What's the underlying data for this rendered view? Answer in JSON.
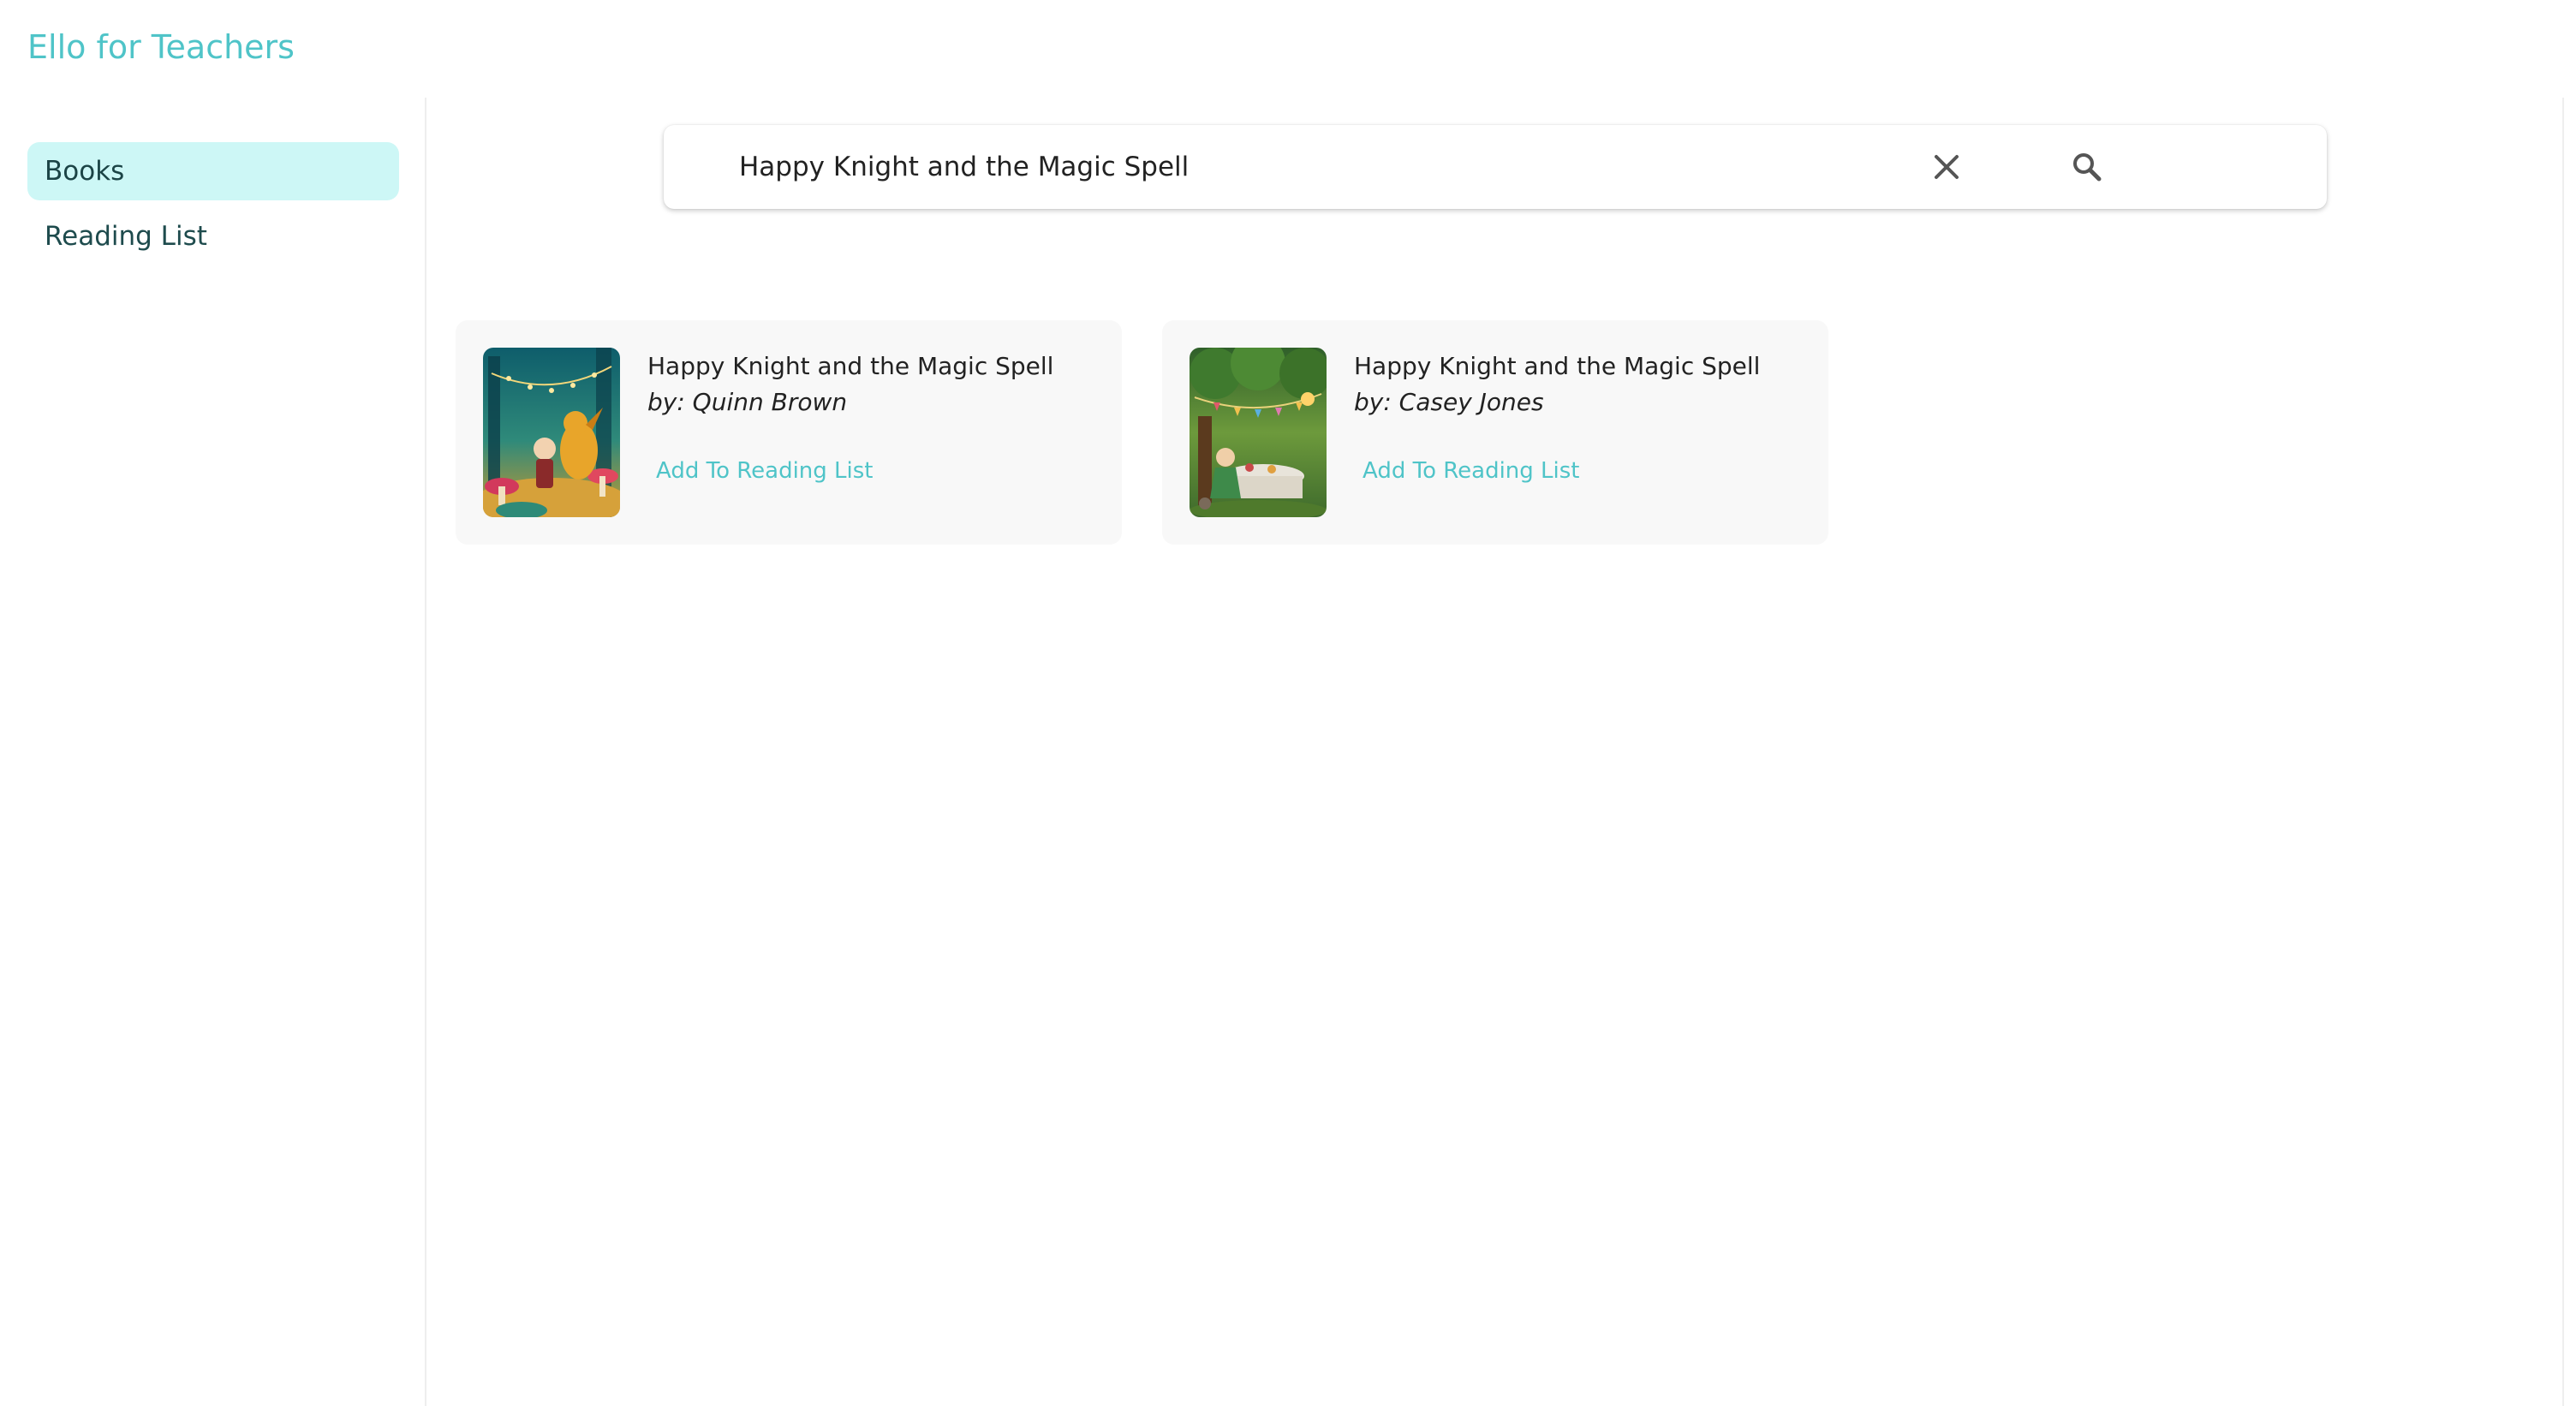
{
  "app": {
    "title": "Ello for Teachers",
    "accent_color": "#4fc4c8",
    "active_nav_bg": "#cdf7f6"
  },
  "sidebar": {
    "items": [
      {
        "label": "Books",
        "active": true
      },
      {
        "label": "Reading List",
        "active": false
      }
    ]
  },
  "search": {
    "value": "Happy Knight and the Magic Spell",
    "clear_icon": "close-icon",
    "search_icon": "search-icon"
  },
  "results": [
    {
      "title": "Happy Knight and the Magic Spell",
      "author": "by: Quinn Brown",
      "action_label": "Add To Reading List",
      "cover_icon": "book-cover-forest-dragon"
    },
    {
      "title": "Happy Knight and the Magic Spell",
      "author": "by: Casey Jones",
      "action_label": "Add To Reading List",
      "cover_icon": "book-cover-garden-tea-party"
    }
  ]
}
